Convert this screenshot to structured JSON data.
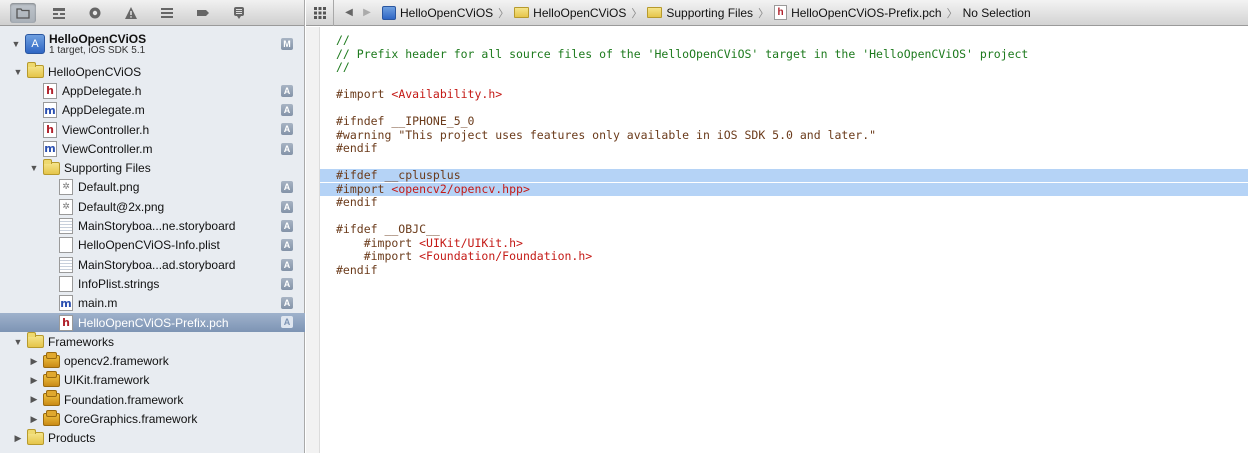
{
  "navigator": {
    "toolbar_tabs": [
      {
        "name": "project-navigator-tab",
        "icon": "folder-icon",
        "active": true
      },
      {
        "name": "symbol-navigator-tab",
        "icon": "hierarchy-icon",
        "active": false
      },
      {
        "name": "search-navigator-tab",
        "icon": "search-icon",
        "active": false
      },
      {
        "name": "issue-navigator-tab",
        "icon": "warning-icon",
        "active": false
      },
      {
        "name": "debug-navigator-tab",
        "icon": "list-icon",
        "active": false
      },
      {
        "name": "breakpoint-navigator-tab",
        "icon": "breakpoint-icon",
        "active": false
      },
      {
        "name": "log-navigator-tab",
        "icon": "speech-bubble-icon",
        "active": false
      }
    ],
    "project": {
      "title": "HelloOpenCViOS",
      "subtitle": "1 target, iOS SDK 5.1",
      "badge": "M"
    },
    "items": [
      {
        "label": "HelloOpenCViOS",
        "kind": "folder",
        "depth": 1,
        "expanded": true,
        "badge": ""
      },
      {
        "label": "AppDelegate.h",
        "kind": "h",
        "depth": 2,
        "badge": "A"
      },
      {
        "label": "AppDelegate.m",
        "kind": "m",
        "depth": 2,
        "badge": "A"
      },
      {
        "label": "ViewController.h",
        "kind": "h",
        "depth": 2,
        "badge": "A"
      },
      {
        "label": "ViewController.m",
        "kind": "m",
        "depth": 2,
        "badge": "A"
      },
      {
        "label": "Supporting Files",
        "kind": "folder",
        "depth": 2,
        "expanded": true,
        "badge": ""
      },
      {
        "label": "Default.png",
        "kind": "img",
        "depth": 3,
        "badge": "A"
      },
      {
        "label": "Default@2x.png",
        "kind": "img",
        "depth": 3,
        "badge": "A"
      },
      {
        "label": "MainStoryboa...ne.storyboard",
        "kind": "doc",
        "depth": 3,
        "badge": "A"
      },
      {
        "label": "HelloOpenCViOS-Info.plist",
        "kind": "blank",
        "depth": 3,
        "badge": "A"
      },
      {
        "label": "MainStoryboa...ad.storyboard",
        "kind": "doc",
        "depth": 3,
        "badge": "A"
      },
      {
        "label": "InfoPlist.strings",
        "kind": "blank",
        "depth": 3,
        "badge": "A"
      },
      {
        "label": "main.m",
        "kind": "m",
        "depth": 3,
        "badge": "A"
      },
      {
        "label": "HelloOpenCViOS-Prefix.pch",
        "kind": "h",
        "depth": 3,
        "badge": "A",
        "selected": true
      },
      {
        "label": "Frameworks",
        "kind": "folder",
        "depth": 1,
        "expanded": true,
        "badge": ""
      },
      {
        "label": "opencv2.framework",
        "kind": "framework",
        "depth": 2,
        "expanded": false,
        "badge": ""
      },
      {
        "label": "UIKit.framework",
        "kind": "framework",
        "depth": 2,
        "expanded": false,
        "badge": ""
      },
      {
        "label": "Foundation.framework",
        "kind": "framework",
        "depth": 2,
        "expanded": false,
        "badge": ""
      },
      {
        "label": "CoreGraphics.framework",
        "kind": "framework",
        "depth": 2,
        "expanded": false,
        "badge": ""
      },
      {
        "label": "Products",
        "kind": "folder",
        "depth": 1,
        "expanded": false,
        "badge": ""
      }
    ]
  },
  "jumpbar": {
    "crumbs": [
      {
        "label": "HelloOpenCViOS",
        "icon": "project-icon"
      },
      {
        "label": "HelloOpenCViOS",
        "icon": "folder-icon"
      },
      {
        "label": "Supporting Files",
        "icon": "folder-icon"
      },
      {
        "label": "HelloOpenCViOS-Prefix.pch",
        "icon": "header-file-icon"
      },
      {
        "label": "No Selection",
        "icon": ""
      }
    ]
  },
  "code": {
    "lines": [
      [
        {
          "t": "//",
          "c": "comment"
        }
      ],
      [
        {
          "t": "// Prefix header for all source files of the 'HelloOpenCViOS' target in the 'HelloOpenCViOS' project",
          "c": "comment"
        }
      ],
      [
        {
          "t": "//",
          "c": "comment"
        }
      ],
      [],
      [
        {
          "t": "#import ",
          "c": "dir"
        },
        {
          "t": "<Availability.h>",
          "c": "str"
        }
      ],
      [],
      [
        {
          "t": "#ifndef __IPHONE_5_0",
          "c": "dir"
        }
      ],
      [
        {
          "t": "#warning ",
          "c": "dir"
        },
        {
          "t": "\"This project uses features only available in iOS SDK 5.0 and later.\"",
          "c": "dir"
        }
      ],
      [
        {
          "t": "#endif",
          "c": "dir"
        }
      ],
      [],
      [
        {
          "t": "#ifdef __cplusplus",
          "c": "dir"
        }
      ],
      [
        {
          "t": "#import ",
          "c": "dir"
        },
        {
          "t": "<opencv2/opencv.hpp>",
          "c": "str"
        }
      ],
      [
        {
          "t": "#endif",
          "c": "dir"
        }
      ],
      [],
      [
        {
          "t": "#ifdef __OBJC__",
          "c": "dir"
        }
      ],
      [
        {
          "t": "    #import ",
          "c": "dir"
        },
        {
          "t": "<UIKit/UIKit.h>",
          "c": "str"
        }
      ],
      [
        {
          "t": "    #import ",
          "c": "dir"
        },
        {
          "t": "<Foundation/Foundation.h>",
          "c": "str"
        }
      ],
      [
        {
          "t": "#endif",
          "c": "dir"
        }
      ]
    ],
    "selection": {
      "full_lines": [
        10,
        11
      ],
      "partial_line": 12
    }
  }
}
